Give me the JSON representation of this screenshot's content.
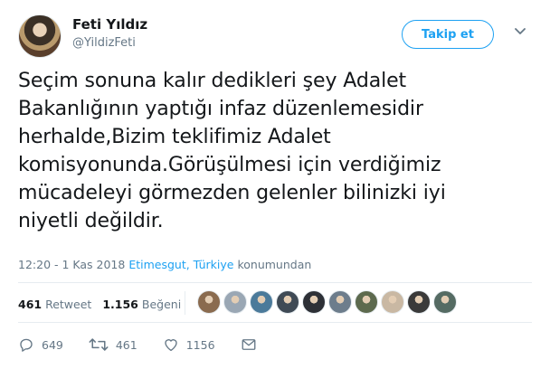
{
  "user": {
    "display_name": "Feti Yıldız",
    "handle": "@YildizFeti"
  },
  "follow_button": {
    "label": "Takip et"
  },
  "tweet": {
    "lines": [
      "Seçim sonuna kalır dedikleri şey Adalet",
      "Bakanlığının yaptığı infaz düzenlemesidir",
      "herhalde,Bizim teklifimiz Adalet",
      "komisyonunda.Görüşülmesi için verdiğimiz",
      "mücadeleyi görmezden gelenler bilinizki iyi",
      "niyetli değildir."
    ],
    "timestamp": "12:20 - 1 Kas 2018",
    "location": "Etimesgut, Türkiye",
    "location_suffix": "konumundan"
  },
  "stats": {
    "retweet_count": "461",
    "retweet_label": "Retweet",
    "like_count": "1.156",
    "like_label": "Beğeni"
  },
  "likers": [
    {
      "name": "liker-avatar-1",
      "color": "#8a6b4f"
    },
    {
      "name": "liker-avatar-2",
      "color": "#9aa7b4"
    },
    {
      "name": "liker-avatar-3",
      "color": "#4b7a9a"
    },
    {
      "name": "liker-avatar-4",
      "color": "#3f4a55"
    },
    {
      "name": "liker-avatar-5",
      "color": "#2d3036"
    },
    {
      "name": "liker-avatar-6",
      "color": "#6d7d8c"
    },
    {
      "name": "liker-avatar-7",
      "color": "#5d6a4e"
    },
    {
      "name": "liker-avatar-8",
      "color": "#c9b8a3"
    },
    {
      "name": "liker-avatar-9",
      "color": "#3a3a3a"
    },
    {
      "name": "liker-avatar-10",
      "color": "#556b63"
    }
  ],
  "actions": {
    "reply_count": "649",
    "retweet_count": "461",
    "like_count": "1156"
  },
  "colors": {
    "accent": "#1da1f2",
    "text": "#14171a",
    "muted": "#657786",
    "border": "#e6ecf0"
  },
  "icons": {
    "caret": "chevron-down-icon",
    "reply": "reply-icon",
    "retweet": "retweet-icon",
    "like": "heart-icon",
    "message": "envelope-icon"
  }
}
